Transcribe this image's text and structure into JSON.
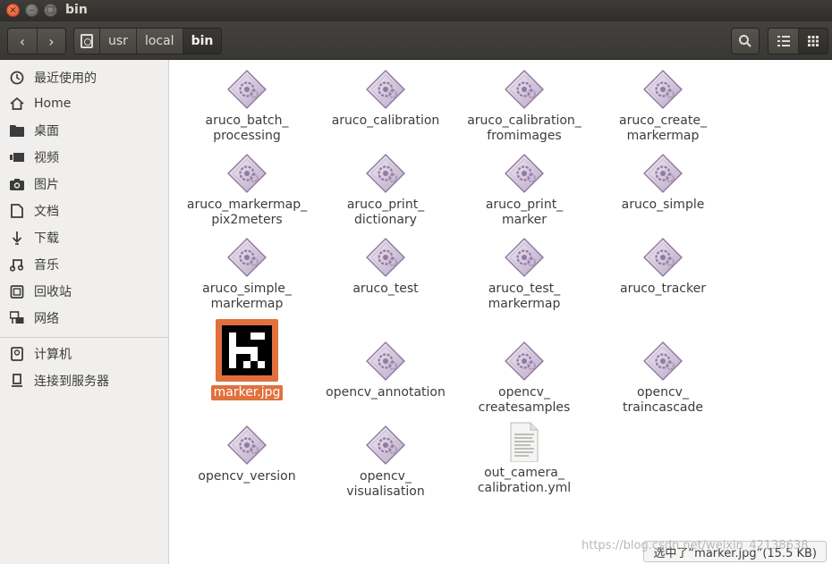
{
  "window": {
    "title": "bin",
    "close_glyph": "×",
    "min_glyph": "–",
    "max_glyph": "□"
  },
  "toolbar": {
    "back_glyph": "‹",
    "forward_glyph": "›",
    "breadcrumbs": [
      "usr",
      "local",
      "bin"
    ],
    "active_crumb": "bin"
  },
  "sidebar": {
    "items": [
      {
        "label": "最近使用的",
        "icon": "clock-icon"
      },
      {
        "label": "Home",
        "icon": "home-icon"
      },
      {
        "label": "桌面",
        "icon": "folder-icon"
      },
      {
        "label": "视频",
        "icon": "video-icon"
      },
      {
        "label": "图片",
        "icon": "camera-icon"
      },
      {
        "label": "文档",
        "icon": "document-icon"
      },
      {
        "label": "下载",
        "icon": "download-icon"
      },
      {
        "label": "音乐",
        "icon": "music-icon"
      },
      {
        "label": "回收站",
        "icon": "trash-icon"
      },
      {
        "label": "网络",
        "icon": "network-icon"
      },
      {
        "label": "计算机",
        "icon": "drive-icon"
      },
      {
        "label": "连接到服务器",
        "icon": "server-icon"
      }
    ]
  },
  "files": [
    {
      "name": "aruco_batch_\nprocessing",
      "type": "executable"
    },
    {
      "name": "aruco_calibration",
      "type": "executable"
    },
    {
      "name": "aruco_calibration_\nfromimages",
      "type": "executable"
    },
    {
      "name": "aruco_create_\nmarkermap",
      "type": "executable"
    },
    {
      "name": "aruco_markermap_\npix2meters",
      "type": "executable"
    },
    {
      "name": "aruco_print_\ndictionary",
      "type": "executable"
    },
    {
      "name": "aruco_print_\nmarker",
      "type": "executable"
    },
    {
      "name": "aruco_simple",
      "type": "executable"
    },
    {
      "name": "aruco_simple_\nmarkermap",
      "type": "executable"
    },
    {
      "name": "aruco_test",
      "type": "executable"
    },
    {
      "name": "aruco_test_\nmarkermap",
      "type": "executable"
    },
    {
      "name": "aruco_tracker",
      "type": "executable"
    },
    {
      "name": "marker.jpg",
      "type": "image",
      "selected": true
    },
    {
      "name": "opencv_annotation",
      "type": "executable"
    },
    {
      "name": "opencv_\ncreatesamples",
      "type": "executable"
    },
    {
      "name": "opencv_\ntraincascade",
      "type": "executable"
    },
    {
      "name": "opencv_version",
      "type": "executable"
    },
    {
      "name": "opencv_\nvisualisation",
      "type": "executable"
    },
    {
      "name": "out_camera_\ncalibration.yml",
      "type": "text"
    }
  ],
  "status": {
    "text": "选中了“marker.jpg”(15.5 KB)"
  },
  "watermark": "https://blog.csdn.net/weixin_42138638",
  "colors": {
    "accent": "#e0703c",
    "toolbar": "#3d3c38",
    "sidebar": "#f0efed"
  }
}
